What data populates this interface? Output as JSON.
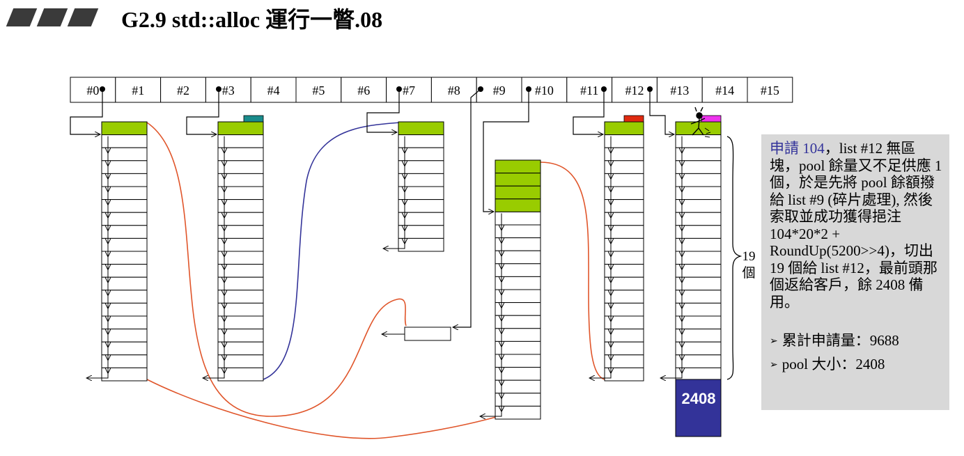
{
  "title": "G2.9 std::alloc 運行一瞥.08",
  "free_list_labels": [
    "#0",
    "#1",
    "#2",
    "#3",
    "#4",
    "#5",
    "#6",
    "#7",
    "#8",
    "#9",
    "#10",
    "#11",
    "#12",
    "#13",
    "#14",
    "#15"
  ],
  "note": {
    "highlight": "申請 104",
    "body": "，list #12 無區塊，pool 餘量又不足供應 1 個，於是先將 pool 餘額撥給 list #9 (碎片處理), 然後索取並成功獲得挹注 104*20*2 + RoundUp(5200>>4)，切出 19 個給 list #12，最前頭那個返給客戶，餘 2408 備用。",
    "stats": [
      {
        "label": "累計申請量：",
        "value": "9688"
      },
      {
        "label": "pool 大小：",
        "value": "2408"
      }
    ]
  },
  "count_label": "19\n個",
  "remaining_pool": "2408",
  "colors": {
    "allocated_block": "#99cc00",
    "pool_block": "#333399",
    "curve_red": "#e0552a",
    "curve_blue": "#333399",
    "marker_teal": "#1a8c8c",
    "marker_red": "#e02a10",
    "marker_magenta": "#ee33ee",
    "note_background": "#d8d8d8"
  }
}
